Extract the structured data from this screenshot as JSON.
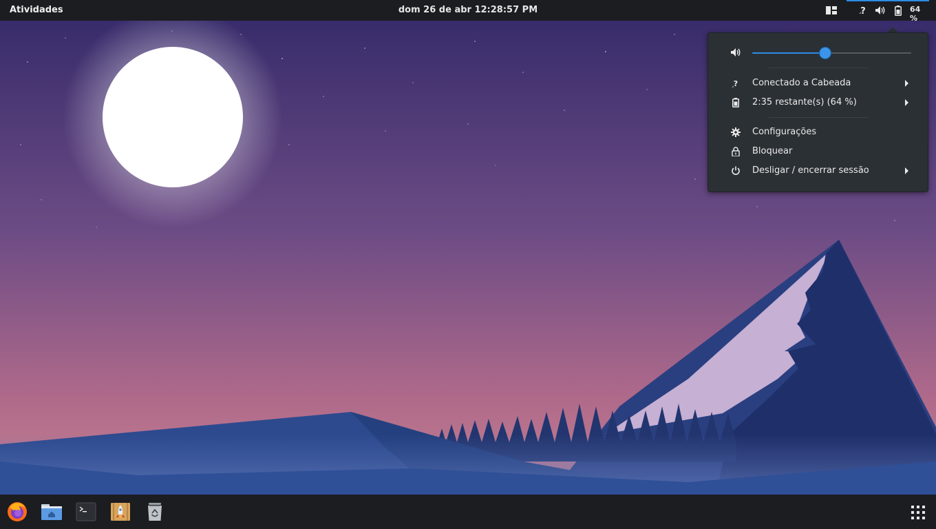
{
  "topbar": {
    "activities_label": "Atividades",
    "clock": "dom 26 de abr  12:28:57 PM",
    "battery_percent": "64 %",
    "layout_icon": "window-layout-icon",
    "network_icon": "network-question-icon",
    "volume_icon": "speaker-icon",
    "battery_icon": "battery-icon",
    "accent_color": "#2d8ce6"
  },
  "system_menu": {
    "volume": {
      "icon": "speaker-icon",
      "level_percent": 46
    },
    "network": {
      "icon": "network-question-icon",
      "label": "Conectado a Cabeada"
    },
    "battery": {
      "icon": "battery-icon",
      "label": "2:35 restante(s) (64 %)"
    },
    "settings": {
      "icon": "gear-icon",
      "label": "Configurações"
    },
    "lock": {
      "icon": "lock-icon",
      "label": "Bloquear"
    },
    "power": {
      "icon": "power-icon",
      "label": "Desligar / encerrar sessão"
    }
  },
  "dock": {
    "items": [
      {
        "name": "firefox",
        "icon": "firefox-icon"
      },
      {
        "name": "files",
        "icon": "home-folder-icon"
      },
      {
        "name": "terminal",
        "icon": "terminal-icon"
      },
      {
        "name": "archive",
        "icon": "archive-rocket-icon"
      },
      {
        "name": "trash",
        "icon": "trash-icon"
      }
    ],
    "apps_grid_icon": "apps-grid-icon"
  },
  "wallpaper": {
    "sky_top": "#3a2d6e",
    "sky_bottom": "#c07a92",
    "moon": "#ffffff",
    "mountain": "#1e2f66",
    "snow": "#c7b2d6"
  }
}
